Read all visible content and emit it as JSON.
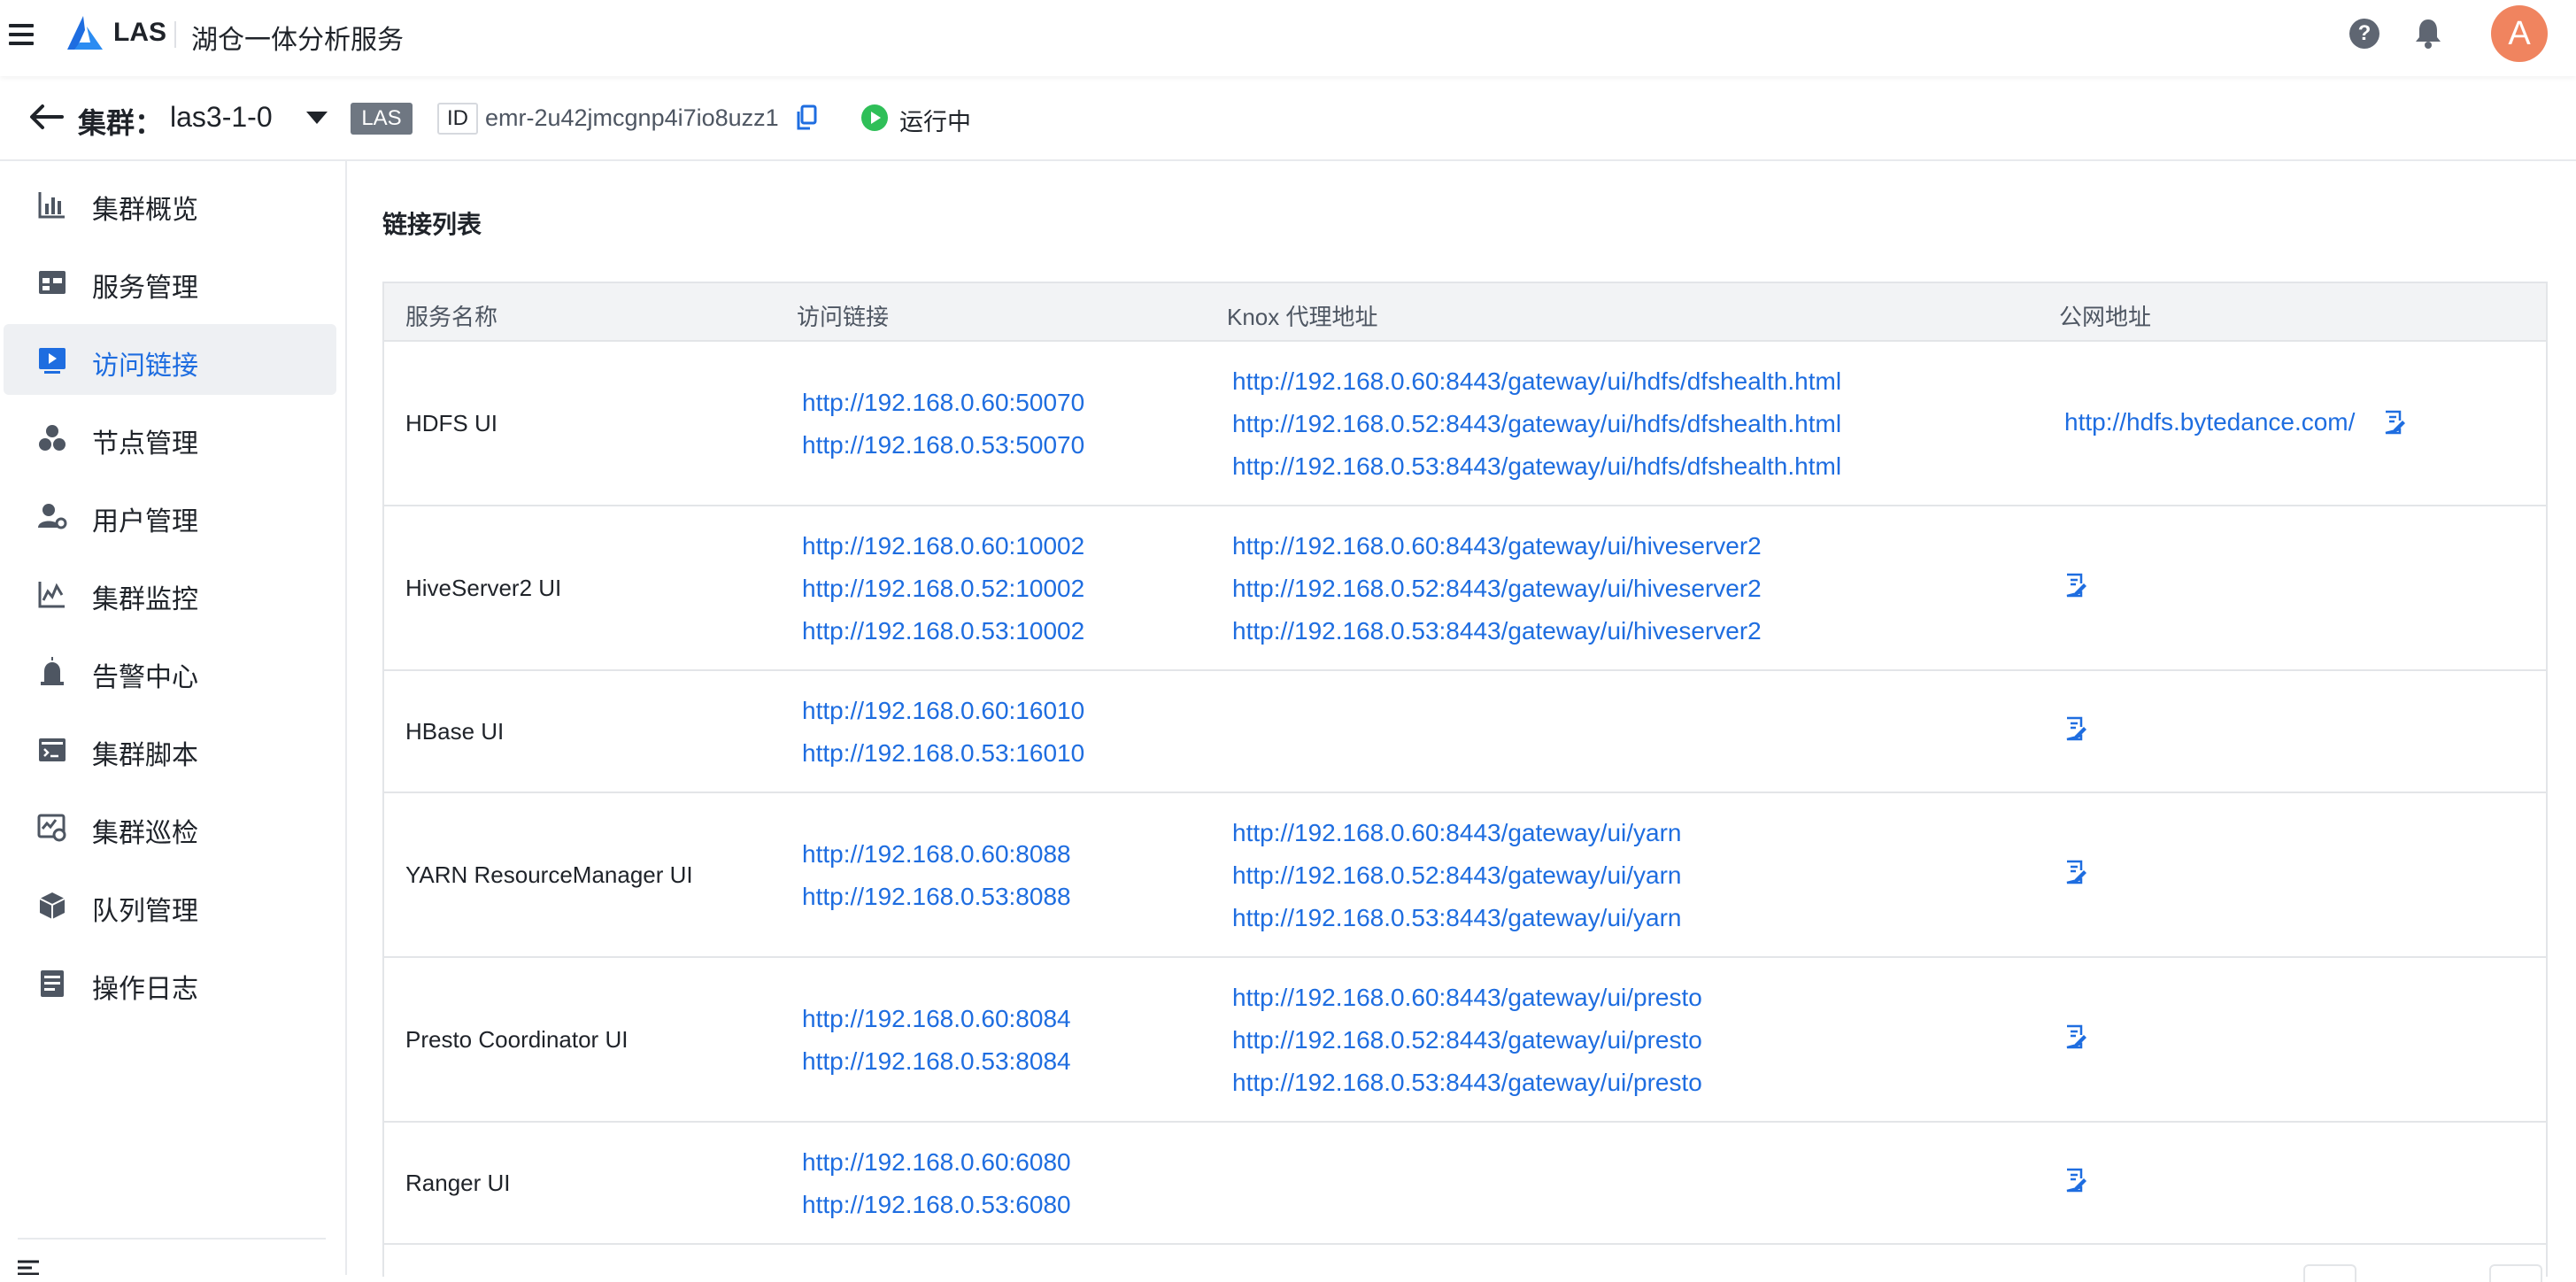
{
  "topbar": {
    "brand": "LAS",
    "product": "湖仓一体分析服务",
    "avatar_letter": "A",
    "help_glyph": "?"
  },
  "cluster": {
    "prefix": "集群：",
    "name": "las3-1-0",
    "tag": "LAS",
    "id_label": "ID",
    "id": "emr-2u42jmcgnp4i7io8uzz1",
    "status": "运行中",
    "status_color": "#2fbf58"
  },
  "sidebar": {
    "items": [
      {
        "label": "集群概览",
        "icon": "bar-chart-icon"
      },
      {
        "label": "服务管理",
        "icon": "grid-panel-icon"
      },
      {
        "label": "访问链接",
        "icon": "play-screen-icon",
        "active": true
      },
      {
        "label": "节点管理",
        "icon": "nodes-icon"
      },
      {
        "label": "用户管理",
        "icon": "user-gear-icon"
      },
      {
        "label": "集群监控",
        "icon": "monitor-chart-icon"
      },
      {
        "label": "告警中心",
        "icon": "alarm-icon"
      },
      {
        "label": "集群脚本",
        "icon": "script-icon"
      },
      {
        "label": "集群巡检",
        "icon": "inspection-icon"
      },
      {
        "label": "队列管理",
        "icon": "cube-icon"
      },
      {
        "label": "操作日志",
        "icon": "log-icon"
      }
    ]
  },
  "main": {
    "section_title": "链接列表",
    "columns": [
      "服务名称",
      "访问链接",
      "Knox 代理地址",
      "公网地址"
    ],
    "rows": [
      {
        "name": "HDFS UI",
        "access": [
          "http://192.168.0.60:50070",
          "http://192.168.0.53:50070"
        ],
        "knox": [
          "http://192.168.0.60:8443/gateway/ui/hdfs/dfshealth.html",
          "http://192.168.0.52:8443/gateway/ui/hdfs/dfshealth.html",
          "http://192.168.0.53:8443/gateway/ui/hdfs/dfshealth.html"
        ],
        "public": "http://hdfs.bytedance.com/"
      },
      {
        "name": "HiveServer2 UI",
        "access": [
          "http://192.168.0.60:10002",
          "http://192.168.0.52:10002",
          "http://192.168.0.53:10002"
        ],
        "knox": [
          "http://192.168.0.60:8443/gateway/ui/hiveserver2",
          "http://192.168.0.52:8443/gateway/ui/hiveserver2",
          "http://192.168.0.53:8443/gateway/ui/hiveserver2"
        ],
        "public": ""
      },
      {
        "name": "HBase UI",
        "access": [
          "http://192.168.0.60:16010",
          "http://192.168.0.53:16010"
        ],
        "knox": [],
        "public": ""
      },
      {
        "name": "YARN ResourceManager UI",
        "access": [
          "http://192.168.0.60:8088",
          "http://192.168.0.53:8088"
        ],
        "knox": [
          "http://192.168.0.60:8443/gateway/ui/yarn",
          "http://192.168.0.52:8443/gateway/ui/yarn",
          "http://192.168.0.53:8443/gateway/ui/yarn"
        ],
        "public": ""
      },
      {
        "name": "Presto Coordinator UI",
        "access": [
          "http://192.168.0.60:8084",
          "http://192.168.0.53:8084"
        ],
        "knox": [
          "http://192.168.0.60:8443/gateway/ui/presto",
          "http://192.168.0.52:8443/gateway/ui/presto",
          "http://192.168.0.53:8443/gateway/ui/presto"
        ],
        "public": ""
      },
      {
        "name": "Ranger UI",
        "access": [
          "http://192.168.0.60:6080",
          "http://192.168.0.53:6080"
        ],
        "knox": [],
        "public": ""
      }
    ]
  },
  "colors": {
    "link": "#1e6de0",
    "accent": "#1e6de0",
    "avatar": "#f0845f"
  }
}
